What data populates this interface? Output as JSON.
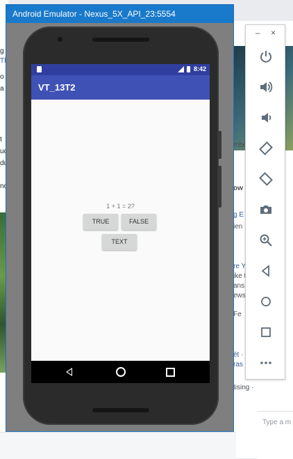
{
  "window": {
    "title": "Android Emulator - Nexus_5X_API_23:5554"
  },
  "status_bar": {
    "time": "8:42"
  },
  "app": {
    "title": "VT_13T2",
    "question": "1 + 1 = 2?",
    "true_label": "TRUE",
    "false_label": "FALSE",
    "text_label": "TEXT"
  },
  "toolbar": {
    "minimize": "–",
    "close": "×",
    "buttons": [
      "power-icon",
      "volume-up-icon",
      "volume-down-icon",
      "rotate-left-icon",
      "rotate-right-icon",
      "camera-icon",
      "zoom-icon",
      "back-icon",
      "home-icon",
      "overview-icon",
      "more-icon"
    ]
  },
  "background": {
    "left": [
      "g",
      "Th",
      "o",
      "a",
      "t",
      "uc",
      "du",
      "no"
    ],
    "right": [
      "mbe",
      "ow",
      "g E",
      "ien",
      "re Y",
      "ike t",
      "ans",
      "ews",
      "Fe",
      "ét ·",
      "ras",
      "tising ·"
    ],
    "message_placeholder": "Type a m"
  }
}
